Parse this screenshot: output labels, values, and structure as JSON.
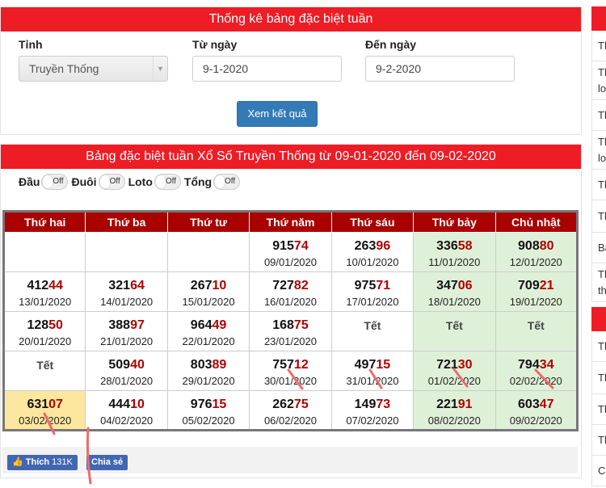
{
  "search": {
    "title": "Thống kê bảng đặc biệt tuần",
    "province_label": "Tỉnh",
    "province_value": "Truyền Thống",
    "from_label": "Từ ngày",
    "from_value": "9-1-2020",
    "to_label": "Đến ngày",
    "to_value": "9-2-2020",
    "submit_label": "Xem kết quả"
  },
  "results": {
    "title": "Bảng đặc biệt tuần Xổ Số Truyền Thống từ 09-01-2020 đến 09-02-2020",
    "toggles": [
      {
        "label": "Đầu",
        "state": "Off"
      },
      {
        "label": "Đuôi",
        "state": "Off"
      },
      {
        "label": "Loto",
        "state": "Off"
      },
      {
        "label": "Tổng",
        "state": "Off"
      }
    ],
    "headers": [
      "Thứ hai",
      "Thứ ba",
      "Thứ tư",
      "Thứ năm",
      "Thứ sáu",
      "Thứ bảy",
      "Chủ nhật"
    ],
    "rows": [
      [
        {
          "empty": true
        },
        {
          "empty": true
        },
        {
          "empty": true
        },
        {
          "pre": "915",
          "hi": "74",
          "date": "09/01/2020"
        },
        {
          "pre": "263",
          "hi": "96",
          "date": "10/01/2020"
        },
        {
          "pre": "336",
          "hi": "58",
          "date": "11/01/2020"
        },
        {
          "pre": "908",
          "hi": "80",
          "date": "12/01/2020"
        }
      ],
      [
        {
          "pre": "412",
          "hi": "44",
          "date": "13/01/2020"
        },
        {
          "pre": "321",
          "hi": "64",
          "date": "14/01/2020"
        },
        {
          "pre": "267",
          "hi": "10",
          "date": "15/01/2020"
        },
        {
          "pre": "727",
          "hi": "82",
          "date": "16/01/2020"
        },
        {
          "pre": "975",
          "hi": "71",
          "date": "17/01/2020"
        },
        {
          "pre": "347",
          "hi": "06",
          "date": "18/01/2020"
        },
        {
          "pre": "709",
          "hi": "21",
          "date": "19/01/2020"
        }
      ],
      [
        {
          "pre": "128",
          "hi": "50",
          "date": "20/01/2020"
        },
        {
          "pre": "388",
          "hi": "97",
          "date": "21/01/2020"
        },
        {
          "pre": "964",
          "hi": "49",
          "date": "22/01/2020"
        },
        {
          "pre": "168",
          "hi": "75",
          "date": "23/01/2020"
        },
        {
          "tet": "Tết"
        },
        {
          "tet": "Tết"
        },
        {
          "tet": "Tết"
        }
      ],
      [
        {
          "tet": "Tết"
        },
        {
          "pre": "509",
          "hi": "40",
          "date": "28/01/2020"
        },
        {
          "pre": "803",
          "hi": "89",
          "date": "29/01/2020"
        },
        {
          "pre": "757",
          "hi": "12",
          "date": "30/01/2020"
        },
        {
          "pre": "497",
          "hi": "15",
          "date": "31/01/2020"
        },
        {
          "pre": "721",
          "hi": "30",
          "date": "01/02/2020"
        },
        {
          "pre": "794",
          "hi": "34",
          "date": "02/02/2020"
        }
      ],
      [
        {
          "pre": "631",
          "hi": "07",
          "date": "03/02/2020",
          "today": true
        },
        {
          "pre": "444",
          "hi": "10",
          "date": "04/02/2020"
        },
        {
          "pre": "976",
          "hi": "15",
          "date": "05/02/2020"
        },
        {
          "pre": "262",
          "hi": "75",
          "date": "06/02/2020"
        },
        {
          "pre": "149",
          "hi": "73",
          "date": "07/02/2020"
        },
        {
          "pre": "221",
          "hi": "91",
          "date": "08/02/2020"
        },
        {
          "pre": "603",
          "hi": "47",
          "date": "09/02/2020"
        }
      ]
    ]
  },
  "social": {
    "like_label": "Thích",
    "like_count": "131K",
    "share_label": "Chia sẻ"
  },
  "sidebar": {
    "items": [
      "Th",
      "Th lo",
      "Th",
      "Th lo",
      "Th",
      "Th",
      "Ba",
      "Th th",
      "Th",
      "Th",
      "Th",
      "Th",
      "Cá"
    ]
  },
  "colors": {
    "header_red": "#ee1c25",
    "table_header": "#a90000",
    "highlight_digits": "#b00000",
    "weekend_bg": "#dff0d8",
    "today_bg": "#fde79e",
    "button_blue": "#337ab7",
    "annotation_stroke": "#f06a6a"
  }
}
